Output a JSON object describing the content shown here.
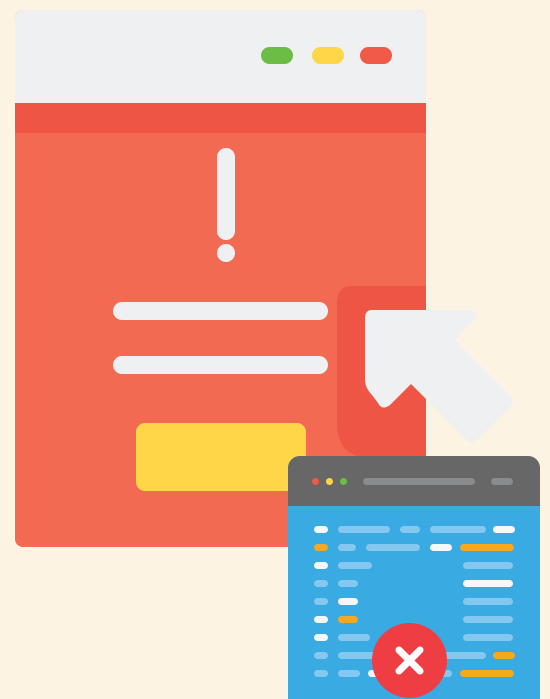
{
  "illustration": {
    "main_window": {
      "traffic_lights": [
        "green",
        "yellow",
        "red"
      ],
      "alert_icon": "exclamation-icon",
      "text_lines": 2,
      "has_action_button": true
    },
    "cursor_icon": "pointer-arrow-icon",
    "code_window": {
      "traffic_lights": [
        "red",
        "yellow",
        "green"
      ],
      "status_icon": "error-x-icon"
    },
    "colors": {
      "background": "#fdf3e3",
      "window_body": "#f26a52",
      "window_titlebar": "#eff0f1",
      "accent_red": "#ef5545",
      "button_yellow": "#fed648",
      "code_bg": "#3aaae3",
      "code_bar": "#676768",
      "error_red": "#ee3e44",
      "highlight_orange": "#f6a821"
    }
  }
}
